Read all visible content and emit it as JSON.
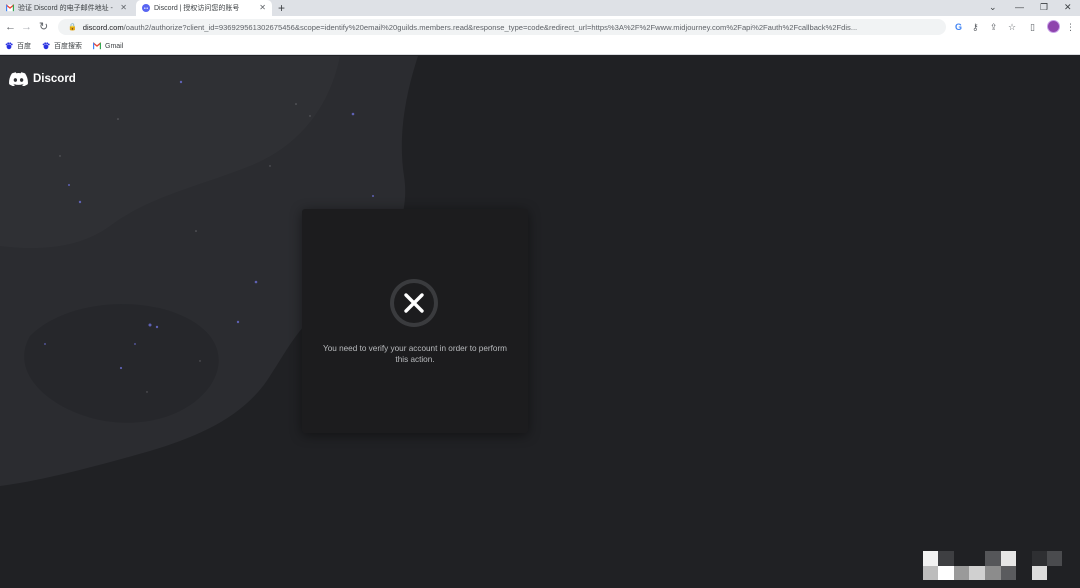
{
  "browser": {
    "tabs": [
      {
        "title": "验证 Discord 的电子邮件地址 - ",
        "close": "✕",
        "active": false
      },
      {
        "title": "Discord | 授权访问您的账号",
        "close": "✕",
        "active": true
      }
    ],
    "new_tab": "+",
    "window_controls": {
      "minimize": "⌄",
      "restore": "—",
      "maximize": "❐",
      "close": "✕"
    },
    "nav": {
      "back": "←",
      "forward": "→",
      "reload": "↻"
    },
    "url": {
      "host": "discord.com",
      "path": "/oauth2/authorize?client_id=936929561302675456&scope=identify%20email%20guilds.members.read&response_type=code&redirect_url=https%3A%2F%2Fwww.midjourney.com%2Fapi%2Fauth%2Fcallback%2Fdis..."
    },
    "bookmarks": [
      {
        "label": "百度",
        "icon": "baidu-icon"
      },
      {
        "label": "百度搜索",
        "icon": "baidu-icon"
      },
      {
        "label": "Gmail",
        "icon": "gmail-icon"
      }
    ]
  },
  "page": {
    "logo_text": "Discord",
    "card": {
      "message": "You need to verify your account in order to perform this action.",
      "icon": "error-x-icon"
    }
  },
  "colors": {
    "background": "#202124",
    "blob": "#2b2c30",
    "card": "#1c1c1e",
    "accent": "#5865f2"
  }
}
